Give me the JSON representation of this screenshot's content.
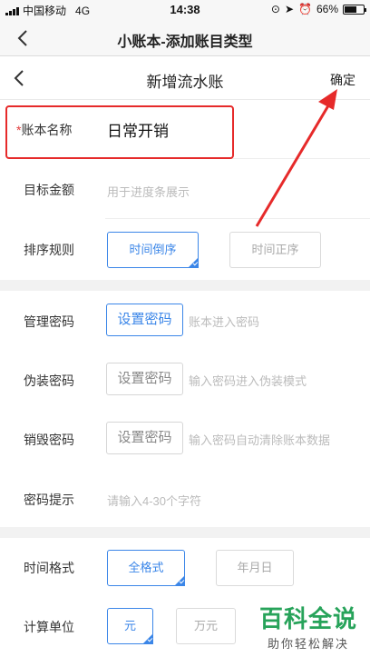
{
  "status_bar": {
    "carrier": "中国移动",
    "network": "4G",
    "time": "14:38",
    "battery": "66%",
    "battery_level": 0.66
  },
  "outer_nav": {
    "title": "小账本-添加账目类型"
  },
  "inner_nav": {
    "title": "新增流水账",
    "confirm_label": "确定"
  },
  "form": {
    "account_name": {
      "required_mark": "*",
      "label": "账本名称",
      "value": "日常开销"
    },
    "target_amount": {
      "label": "目标金额",
      "placeholder": "用于进度条展示"
    },
    "sort_rule": {
      "label": "排序规则",
      "options": [
        "时间倒序",
        "时间正序"
      ],
      "selected": "时间倒序"
    },
    "manage_password": {
      "label": "管理密码",
      "button": "设置密码",
      "hint": "账本进入密码"
    },
    "fake_password": {
      "label": "伪装密码",
      "button": "设置密码",
      "hint": "输入密码进入伪装模式"
    },
    "destroy_password": {
      "label": "销毁密码",
      "button": "设置密码",
      "hint": "输入密码自动清除账本数据"
    },
    "password_hint": {
      "label": "密码提示",
      "placeholder": "请输入4-30个字符"
    },
    "time_format": {
      "label": "时间格式",
      "options": [
        "全格式",
        "年月日"
      ],
      "selected": "全格式"
    },
    "unit": {
      "label": "计算单位",
      "options": [
        "元",
        "万元"
      ],
      "selected": "元"
    }
  },
  "watermark": {
    "brand": "百科全说",
    "slogan": "助你轻松解决"
  },
  "colors": {
    "accent": "#3b86e8",
    "highlight": "#e62a2a",
    "watermark": "#27a35a"
  }
}
